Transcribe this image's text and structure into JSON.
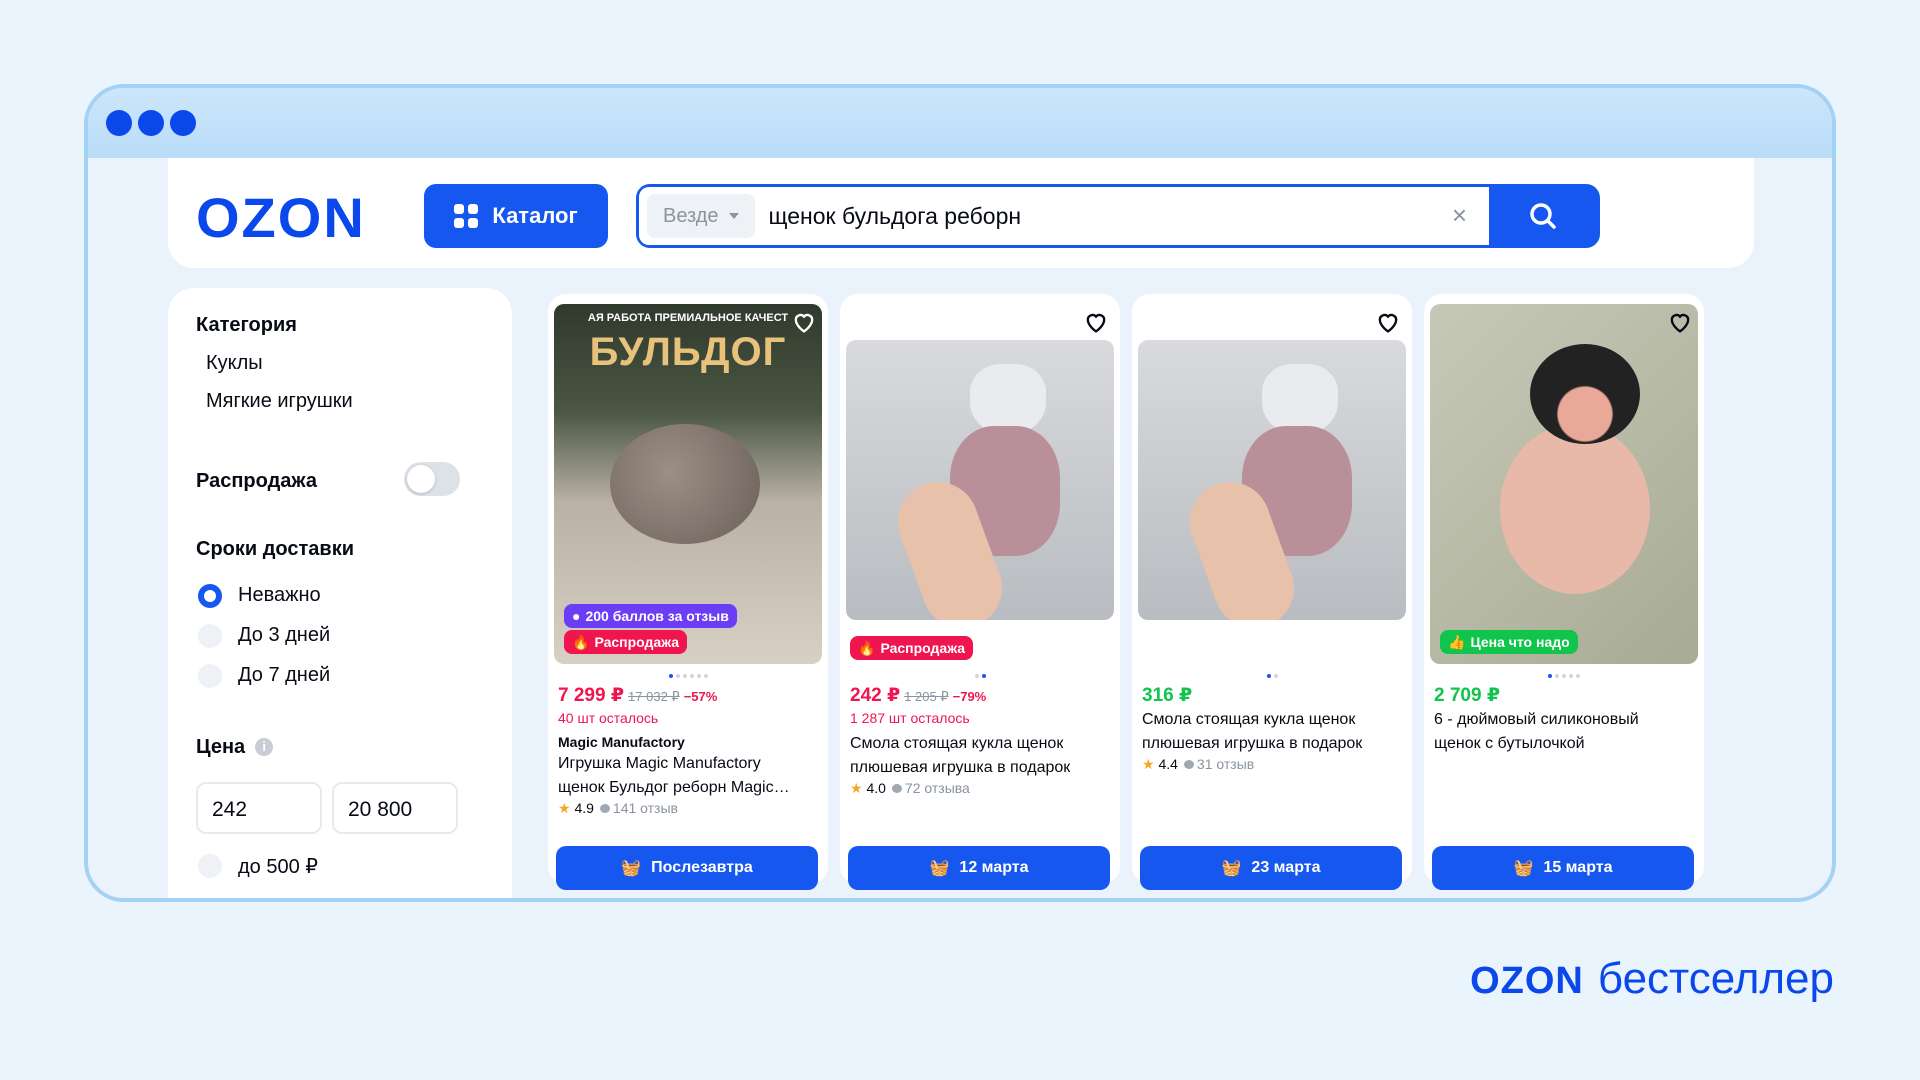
{
  "header": {
    "logo": "OZON",
    "catalog_label": "Каталог",
    "search_scope": "Везде",
    "search_query": "щенок бульдога реборн",
    "clear_label": "×"
  },
  "sidebar": {
    "category_title": "Категория",
    "categories": [
      "Куклы",
      "Мягкие игрушки"
    ],
    "sale_label": "Распродажа",
    "delivery_title": "Сроки доставки",
    "delivery_options": [
      "Неважно",
      "До 3 дней",
      "До 7 дней"
    ],
    "delivery_selected": "Неважно",
    "price_title": "Цена",
    "price_from": "242",
    "price_to": "20 800",
    "price_preset": "до 500 ₽"
  },
  "products": [
    {
      "image_text": "БУЛЬДОГ",
      "image_banner": "АЯ РАБОТА   ПРЕМИАЛЬНОЕ КАЧЕСТ",
      "badge_points": "200 баллов за отзыв",
      "badge": "Распродажа",
      "price": "7 299 ₽",
      "old_price": "17 032 ₽",
      "discount": "−57%",
      "stock": "40 шт осталось",
      "brand": "Magic Manufactory",
      "title_line1": "Игрушка Magic Manufactory",
      "title_line2": "щенок Бульдог реборн Magic…",
      "rating": "4.9",
      "reviews": "141 отзыв",
      "delivery": "Послезавтра"
    },
    {
      "badge": "Распродажа",
      "price": "242 ₽",
      "old_price": "1 205 ₽",
      "discount": "−79%",
      "stock": "1 287 шт осталось",
      "title_line1": "Смола стоящая кукла щенок",
      "title_line2": "плюшевая игрушка в подарок",
      "rating": "4.0",
      "reviews": "72 отзыва",
      "delivery": "12 марта"
    },
    {
      "price": "316 ₽",
      "title_line1": "Смола стоящая кукла щенок",
      "title_line2": "плюшевая игрушка в подарок",
      "rating": "4.4",
      "reviews": "31 отзыв",
      "delivery": "23 марта"
    },
    {
      "badge": "Цена что надо",
      "price": "2 709 ₽",
      "title_line1": "6 - дюймовый силиконовый",
      "title_line2": "щенок с бутылочкой",
      "delivery": "15 марта"
    }
  ],
  "footer": {
    "logo": "OZON",
    "tagline": "бестселлер"
  },
  "colors": {
    "brand": "#0a48ec",
    "accent": "#1657f0",
    "sale": "#f0144f",
    "good_price": "#10c44c"
  }
}
